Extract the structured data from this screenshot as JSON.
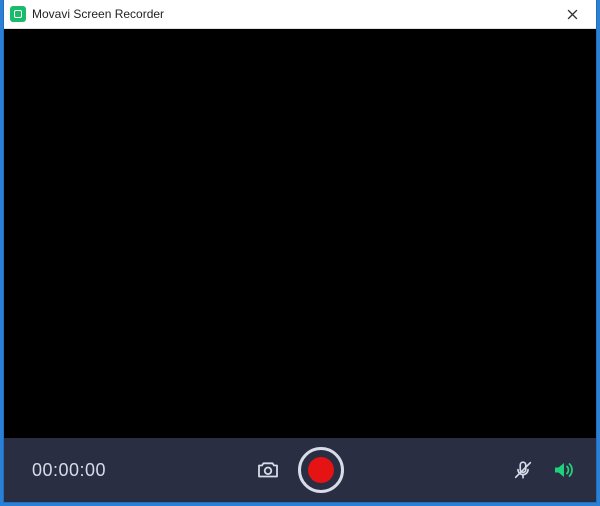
{
  "window": {
    "title": "Movavi Screen Recorder",
    "icon": "movavi-app-icon",
    "close_label": "Close"
  },
  "controls": {
    "timer": "00:00:00",
    "screenshot_label": "Take screenshot",
    "record_label": "Start recording",
    "mic_label": "Microphone (muted)",
    "speaker_label": "System audio (on)"
  },
  "colors": {
    "accent": "#1fd17a",
    "record": "#e51313",
    "panel": "#2a2e42"
  }
}
